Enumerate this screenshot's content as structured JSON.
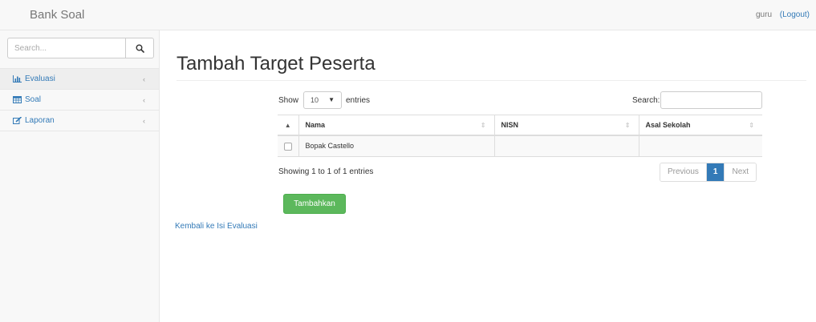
{
  "navbar": {
    "brand": "Bank Soal",
    "user": "guru",
    "logout": "(Logout)"
  },
  "sidebar": {
    "search_placeholder": "Search...",
    "items": [
      {
        "label": "Evaluasi",
        "icon": "bar-chart-icon"
      },
      {
        "label": "Soal",
        "icon": "table-icon"
      },
      {
        "label": "Laporan",
        "icon": "edit-icon"
      }
    ]
  },
  "main": {
    "title": "Tambah Target Peserta",
    "show_label": "Show",
    "entries_value": "10",
    "entries_label": "entries",
    "search_label": "Search:",
    "columns": [
      "Nama",
      "NISN",
      "Asal Sekolah"
    ],
    "rows": [
      {
        "nama": "Bopak Castello",
        "nisn": "",
        "asal_sekolah": ""
      }
    ],
    "info": "Showing 1 to 1 of 1 entries",
    "pagination": {
      "previous": "Previous",
      "current": "1",
      "next": "Next"
    },
    "add_button": "Tambahkan",
    "back_link": "Kembali ke Isi Evaluasi"
  },
  "colors": {
    "link": "#337ab7",
    "success": "#5cb85c",
    "page_active": "#337ab7"
  }
}
